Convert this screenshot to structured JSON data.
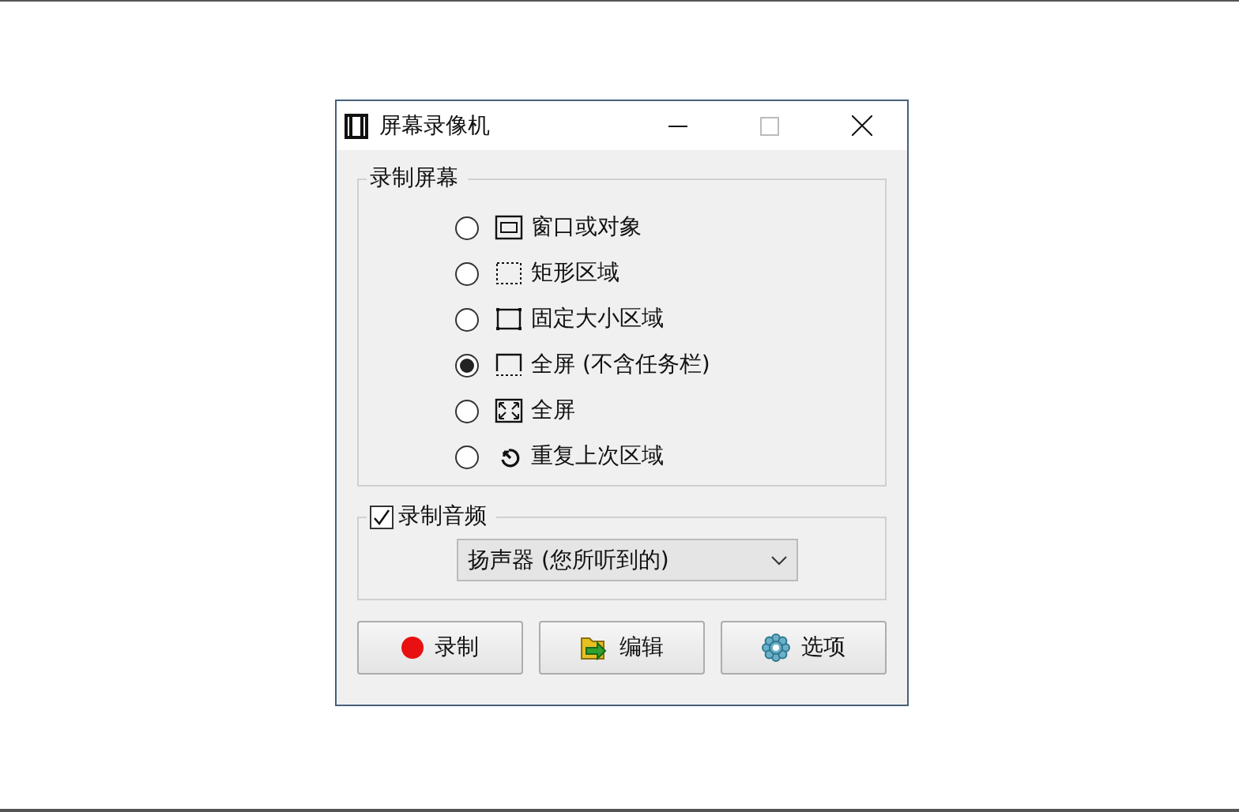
{
  "window": {
    "title": "屏幕录像机"
  },
  "screen_group": {
    "label": "录制屏幕",
    "options": [
      {
        "kind": "window",
        "label": "窗口或对象",
        "selected": false
      },
      {
        "kind": "region",
        "label": "矩形区域",
        "selected": false
      },
      {
        "kind": "fixed",
        "label": "固定大小区域",
        "selected": false
      },
      {
        "kind": "no-taskbar",
        "label": "全屏 (不含任务栏)",
        "selected": true
      },
      {
        "kind": "fullscreen",
        "label": "全屏",
        "selected": false
      },
      {
        "kind": "repeat",
        "label": "重复上次区域",
        "selected": false
      }
    ]
  },
  "audio_group": {
    "label": "录制音频",
    "checked": true,
    "source": "扬声器 (您所听到的)"
  },
  "buttons": [
    {
      "kind": "record",
      "label": "录制"
    },
    {
      "kind": "edit",
      "label": "编辑"
    },
    {
      "kind": "options",
      "label": "选项"
    }
  ]
}
